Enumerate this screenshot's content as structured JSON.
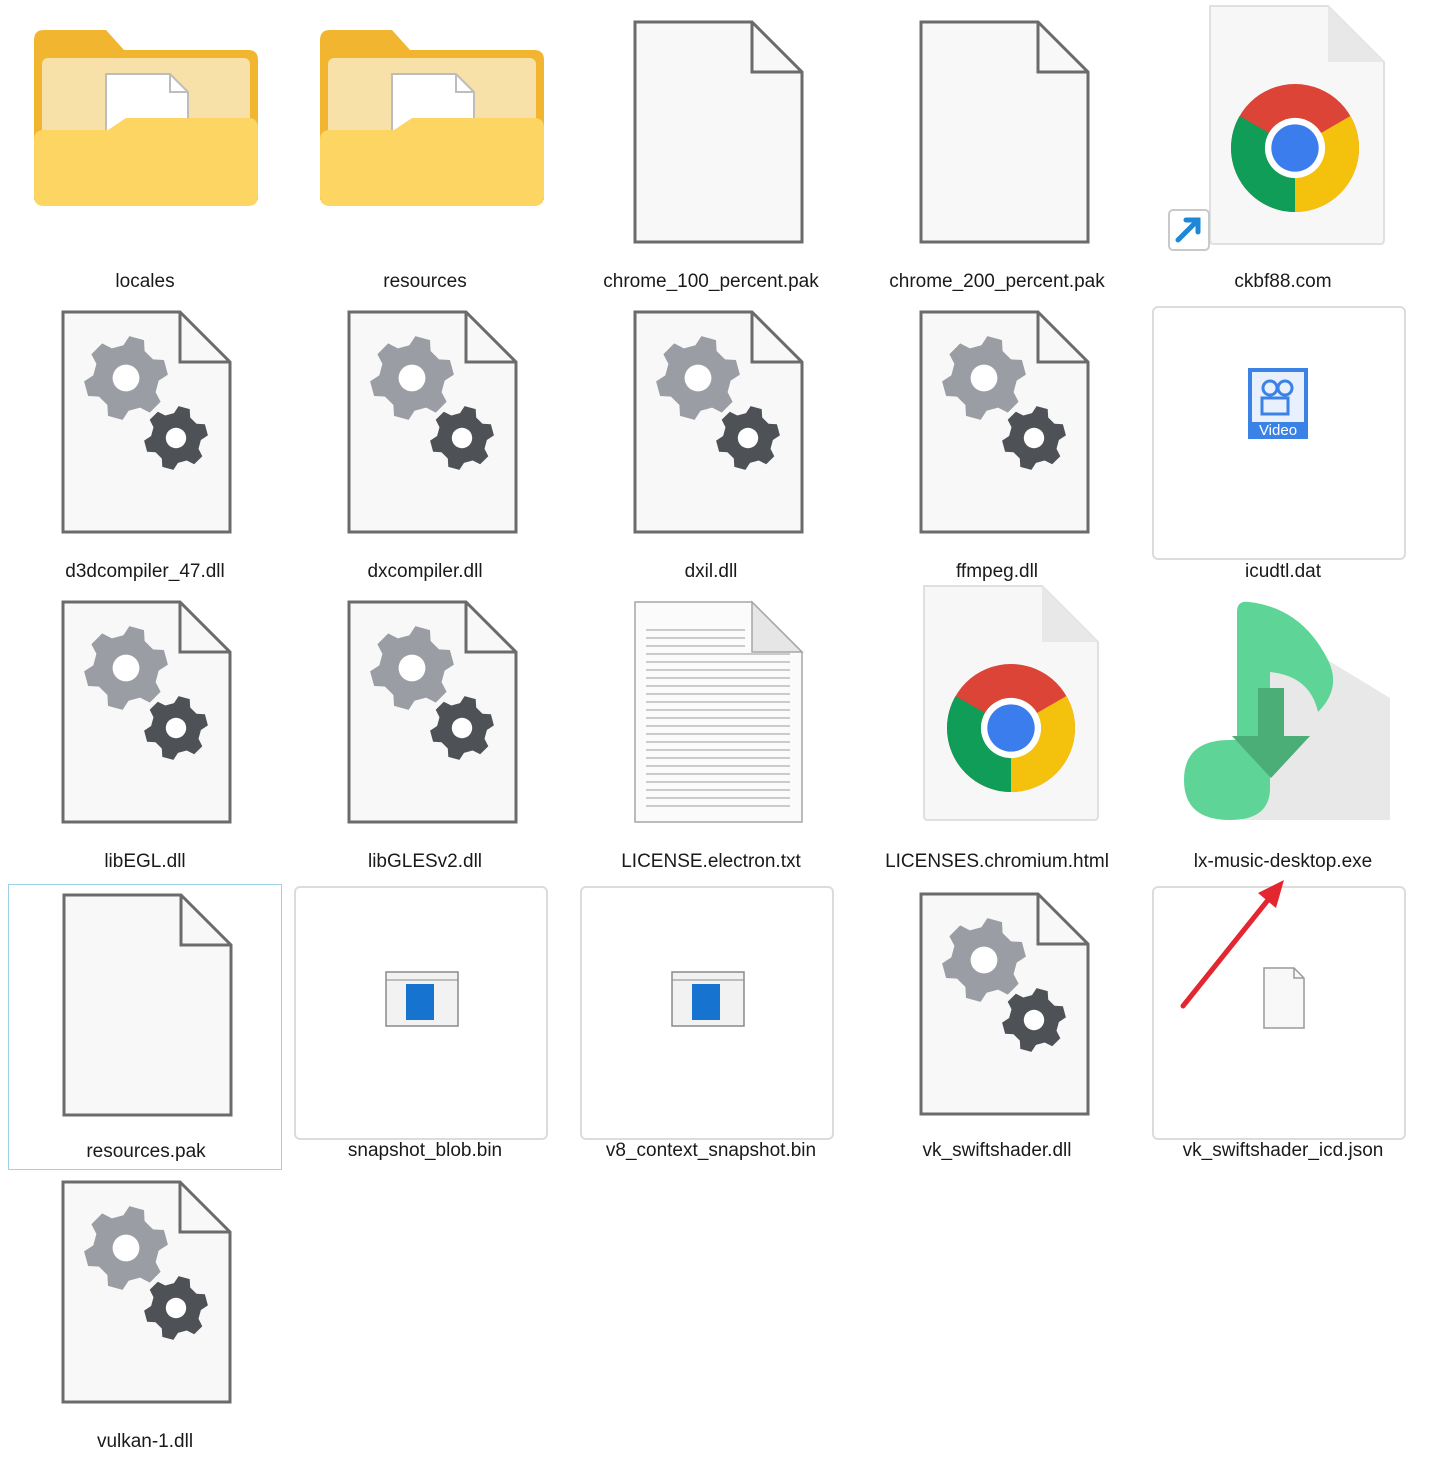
{
  "files": [
    {
      "name": "locales",
      "type": "folder"
    },
    {
      "name": "resources",
      "type": "folder"
    },
    {
      "name": "chrome_100_percent.pak",
      "type": "blank-file"
    },
    {
      "name": "chrome_200_percent.pak",
      "type": "blank-file"
    },
    {
      "name": "ckbf88.com",
      "type": "chrome-shortcut"
    },
    {
      "name": "d3dcompiler_47.dll",
      "type": "dll"
    },
    {
      "name": "dxcompiler.dll",
      "type": "dll"
    },
    {
      "name": "dxil.dll",
      "type": "dll"
    },
    {
      "name": "ffmpeg.dll",
      "type": "dll"
    },
    {
      "name": "icudtl.dat",
      "type": "video-thumbnail",
      "badge": "Video"
    },
    {
      "name": "libEGL.dll",
      "type": "dll"
    },
    {
      "name": "libGLESv2.dll",
      "type": "dll"
    },
    {
      "name": "LICENSE.electron.txt",
      "type": "text-file"
    },
    {
      "name": "LICENSES.chromium.html",
      "type": "chrome-html"
    },
    {
      "name": "lx-music-desktop.exe",
      "type": "lx-music-app"
    },
    {
      "name": "resources.pak",
      "type": "blank-file",
      "selected": true
    },
    {
      "name": "snapshot_blob.bin",
      "type": "window-thumbnail"
    },
    {
      "name": "v8_context_snapshot.bin",
      "type": "window-thumbnail"
    },
    {
      "name": "vk_swiftshader.dll",
      "type": "dll"
    },
    {
      "name": "vk_swiftshader_icd.json",
      "type": "small-file-thumbnail"
    },
    {
      "name": "vulkan-1.dll",
      "type": "dll"
    }
  ],
  "icons": {
    "folder": "folder-icon",
    "blank-file": "blank-file-icon",
    "chrome-shortcut": "chrome-shortcut-icon",
    "dll": "dll-gears-icon",
    "video-thumbnail": "video-file-icon",
    "text-file": "text-document-icon",
    "chrome-html": "chrome-html-icon",
    "lx-music-app": "lx-music-icon",
    "window-thumbnail": "window-thumbnail-icon",
    "small-file-thumbnail": "blank-file-icon"
  },
  "colors": {
    "folder_back": "#f2b530",
    "folder_front": "#fdd563",
    "dll_gear_light": "#9a9ea4",
    "dll_gear_dark": "#4e5257",
    "lx_green": "#5ed496",
    "lx_arrow": "#4aae76",
    "annotation_arrow": "#e3262f",
    "selection_border": "#9fd2e6",
    "video_badge": "#3b82e6"
  },
  "annotation": {
    "type": "red-arrow",
    "points_to": "lx-music-desktop.exe"
  }
}
